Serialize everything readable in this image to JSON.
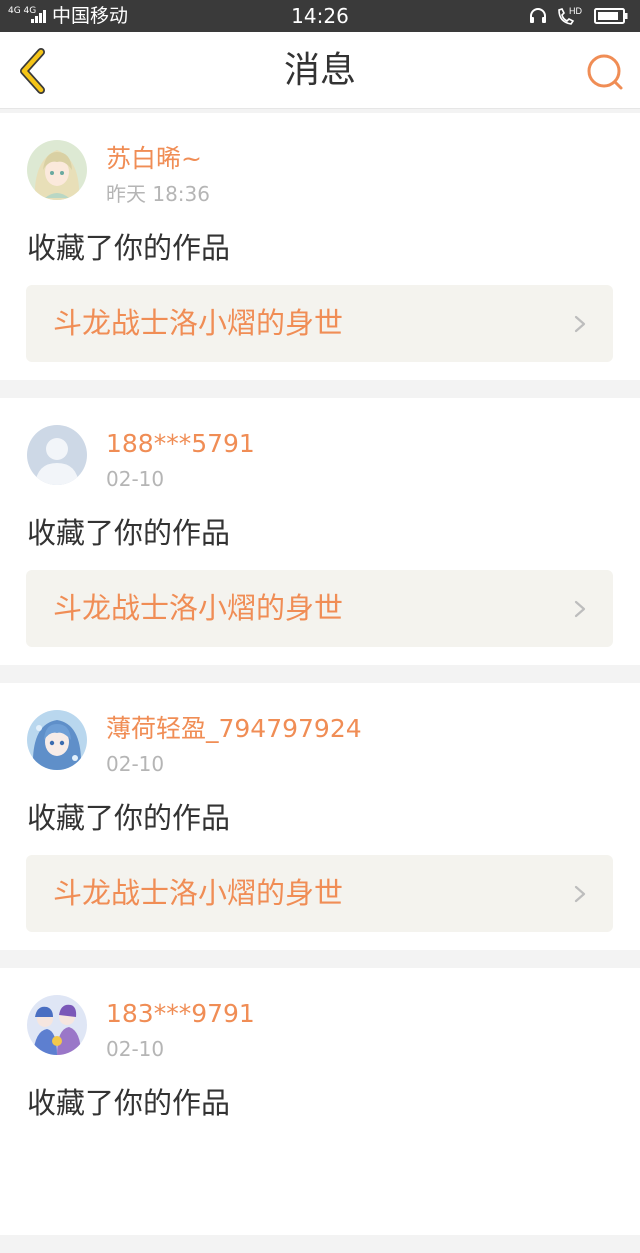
{
  "status_bar": {
    "network": "4G 4G",
    "carrier": "中国移动",
    "time": "14:26",
    "hd_label": "HD"
  },
  "nav": {
    "title": "消息",
    "back_icon": "chevron-left-icon",
    "search_icon": "search-icon"
  },
  "colors": {
    "accent": "#f08d55",
    "back_arrow": "#f5c518",
    "timestamp": "#b5b5b5",
    "link_bg": "#f4f3ee"
  },
  "messages": [
    {
      "username": "苏白晞~",
      "time": "昨天 18:36",
      "action": "收藏了你的作品",
      "work_title": "斗龙战士洛小熠的身世",
      "avatar": "anime-girl-avatar"
    },
    {
      "username": "188***5791",
      "time": "02-10",
      "action": "收藏了你的作品",
      "work_title": "斗龙战士洛小熠的身世",
      "avatar": "default-user-avatar"
    },
    {
      "username": "薄荷轻盈_794797924",
      "time": "02-10",
      "action": "收藏了你的作品",
      "work_title": "斗龙战士洛小熠的身世",
      "avatar": "anime-blue-avatar"
    },
    {
      "username": "183***9791",
      "time": "02-10",
      "action": "收藏了你的作品",
      "work_title": "",
      "avatar": "anime-group-avatar"
    }
  ]
}
